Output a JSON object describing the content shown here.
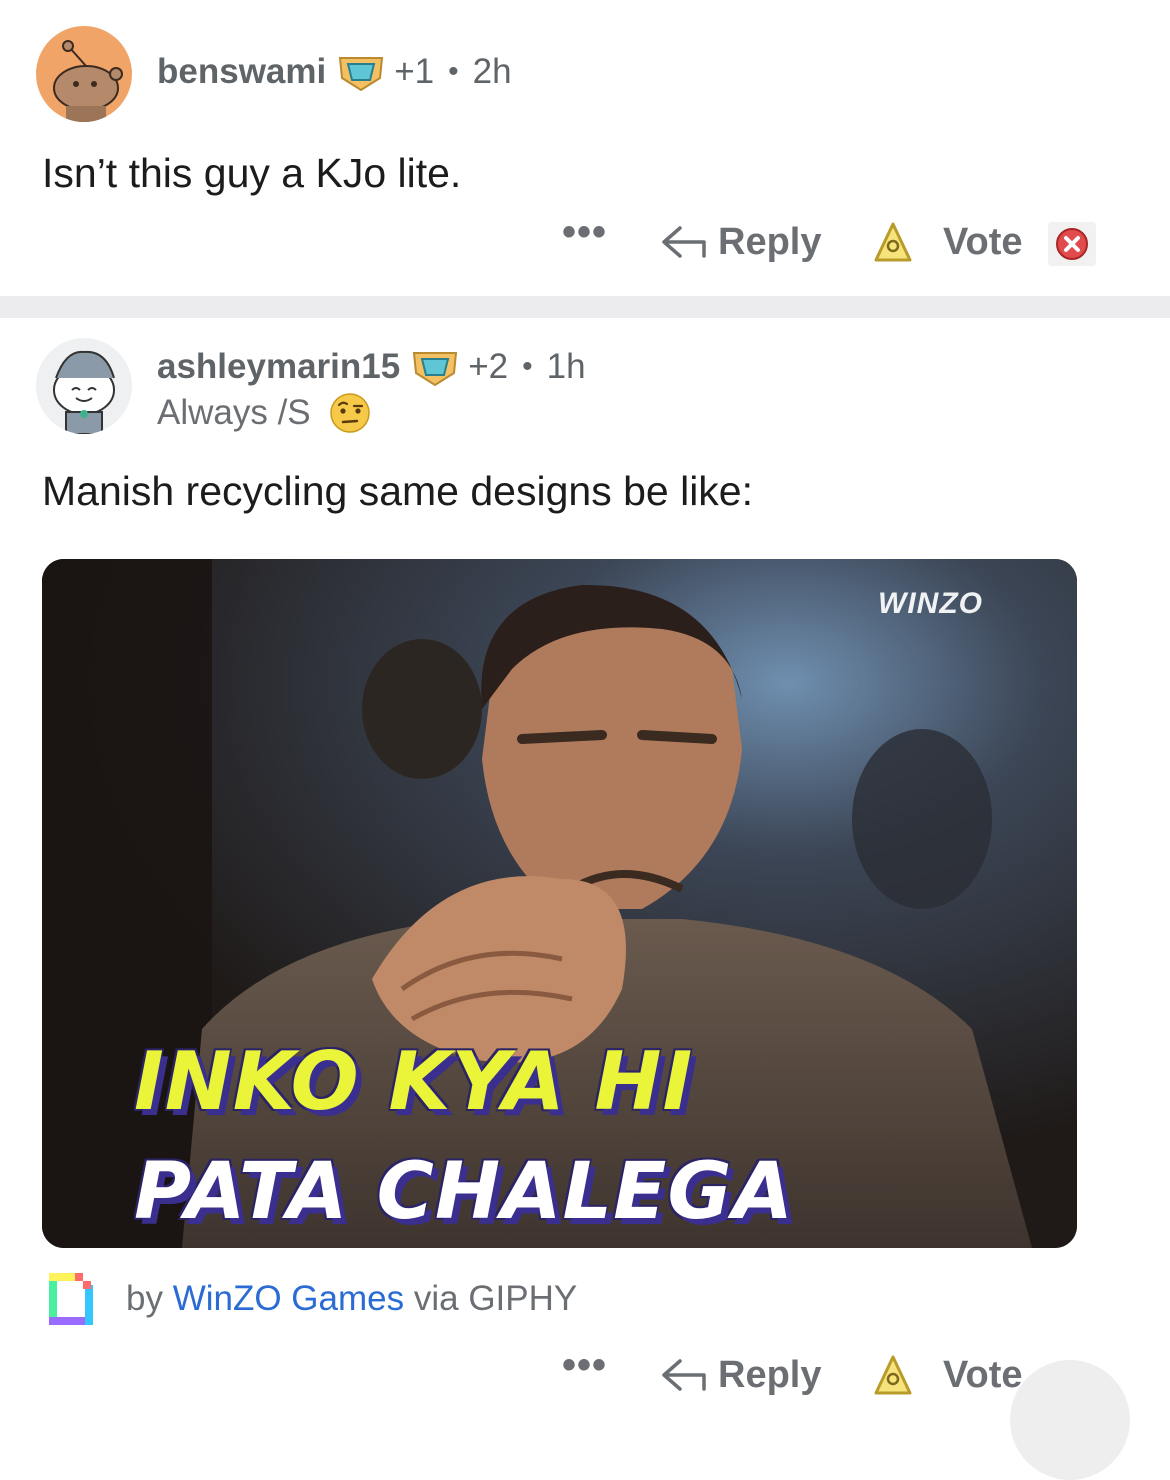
{
  "comments": [
    {
      "username": "benswami",
      "score": "+1",
      "separator": "•",
      "time": "2h",
      "body": "Isn’t this guy a KJo lite.",
      "actions": {
        "more": "•••",
        "reply": "Reply",
        "vote": "Vote"
      }
    },
    {
      "username": "ashleymarin15",
      "score": "+2",
      "separator": "•",
      "time": "1h",
      "flair": "Always /S",
      "body": "Manish recycling same designs be like:",
      "gif": {
        "watermark": "WINZO",
        "caption_line1": "INKO KYA HI",
        "caption_line2": "PATA CHALEGA"
      },
      "attribution": {
        "prefix": "by",
        "author": "WinZO Games",
        "suffix": "via GIPHY"
      },
      "actions": {
        "more": "•••",
        "reply": "Reply",
        "vote": "Vote"
      }
    }
  ],
  "colors": {
    "meta_text": "#5f6468",
    "link_blue": "#2a6bd4",
    "separator": "#ececee",
    "caption_yellow": "#eaf53a"
  }
}
